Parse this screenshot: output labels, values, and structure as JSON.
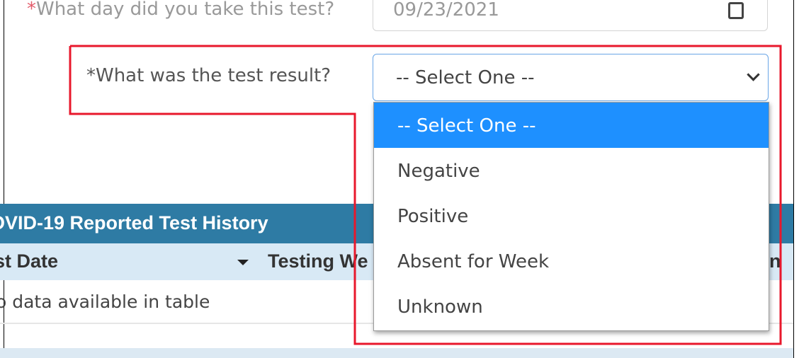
{
  "form": {
    "date_question": {
      "required_mark": "*",
      "text": "What day did you take this test?"
    },
    "date_value": "09/23/2021",
    "result_question": {
      "required_mark": "*",
      "text": "What was the test result?"
    },
    "result_selected": "-- Select One --",
    "result_options": [
      "-- Select One --",
      "Negative",
      "Positive",
      "Absent for Week",
      "Unknown"
    ]
  },
  "history": {
    "title": "OVID-19 Reported Test History",
    "columns": [
      "st Date",
      "Testing We",
      "n"
    ],
    "empty_message": "o data available in table"
  },
  "colors": {
    "highlight": "#e8182c",
    "header": "#2e7ba4",
    "column_header": "#d8e9f5",
    "selected_option": "#1e90ff"
  }
}
